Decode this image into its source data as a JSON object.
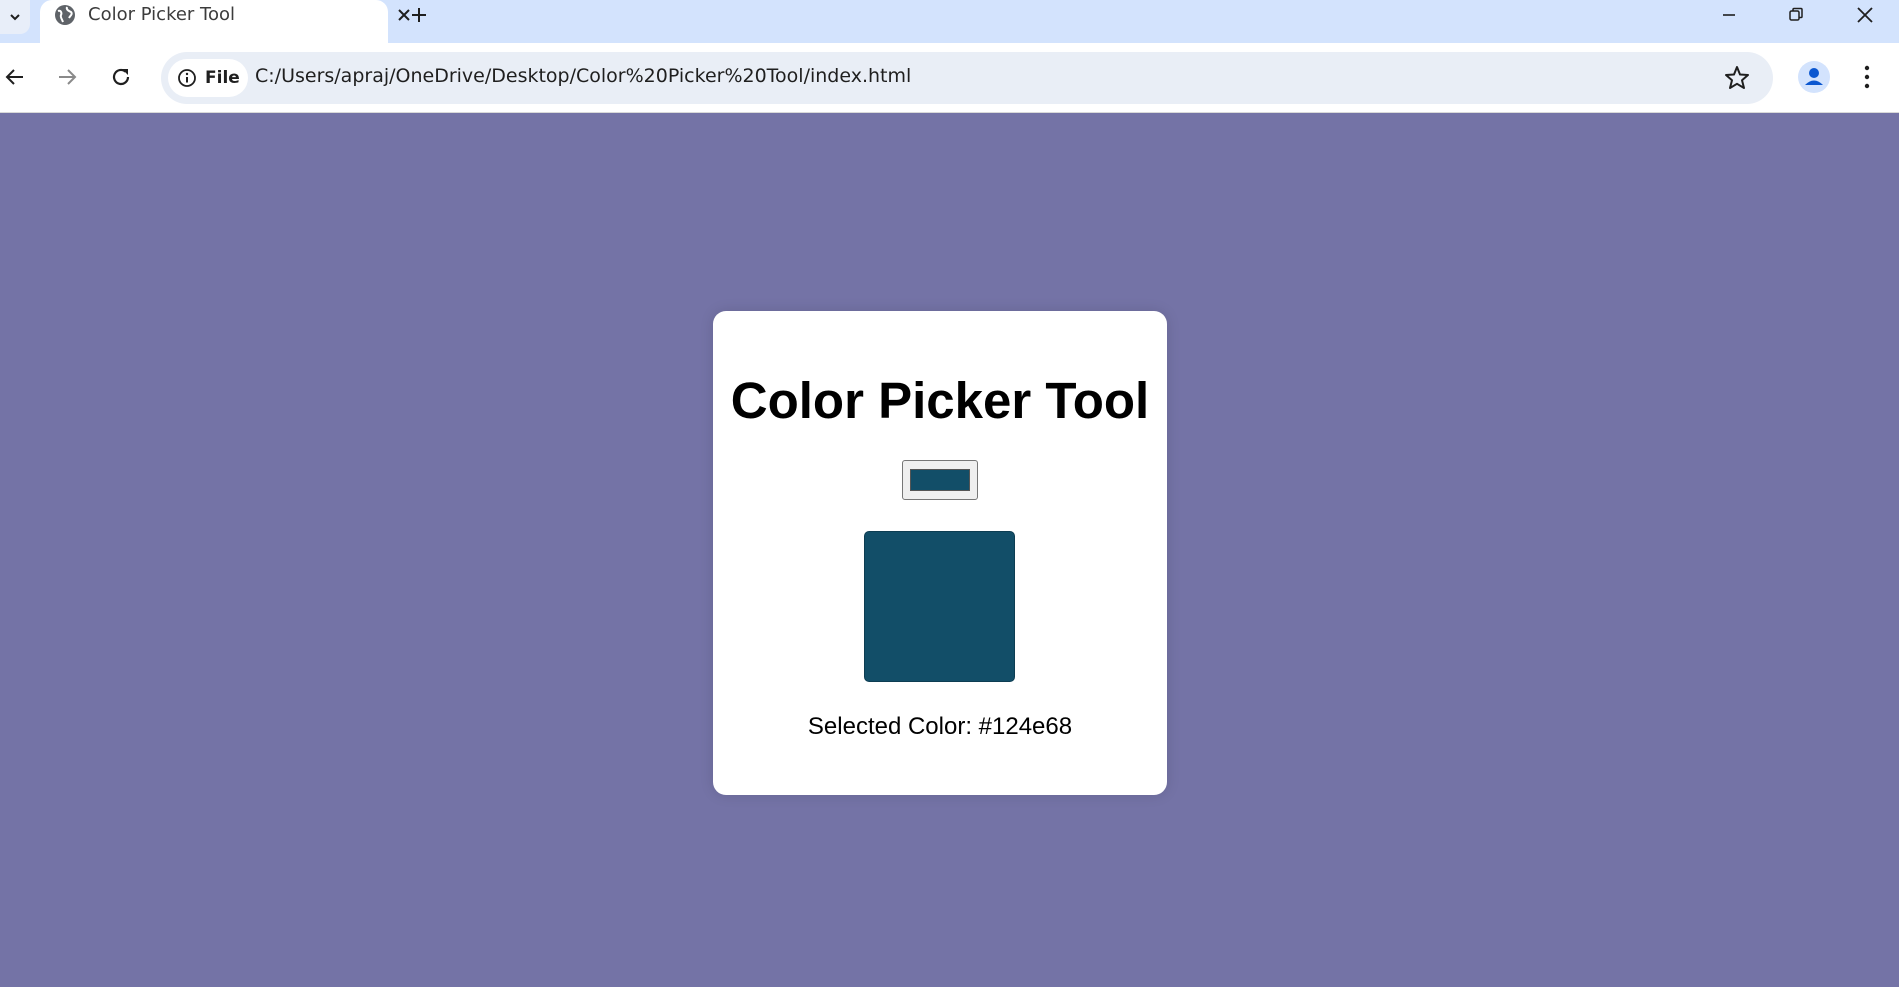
{
  "browser": {
    "tab": {
      "title": "Color Picker Tool"
    },
    "address": {
      "scheme_label": "File",
      "url": "C:/Users/apraj/OneDrive/Desktop/Color%20Picker%20Tool/index.html"
    },
    "icons": [
      "chevron-down-icon",
      "globe-icon",
      "close-icon",
      "plus-icon",
      "minimize-icon",
      "restore-icon",
      "close-window-icon",
      "back-arrow-icon",
      "forward-arrow-icon",
      "reload-icon",
      "info-icon",
      "star-icon",
      "profile-icon",
      "more-vert-icon"
    ]
  },
  "page": {
    "background_color": "#7473a6",
    "title": "Color Picker Tool",
    "selected_color": "#124e68",
    "selected_label": "Selected Color: #124e68"
  }
}
